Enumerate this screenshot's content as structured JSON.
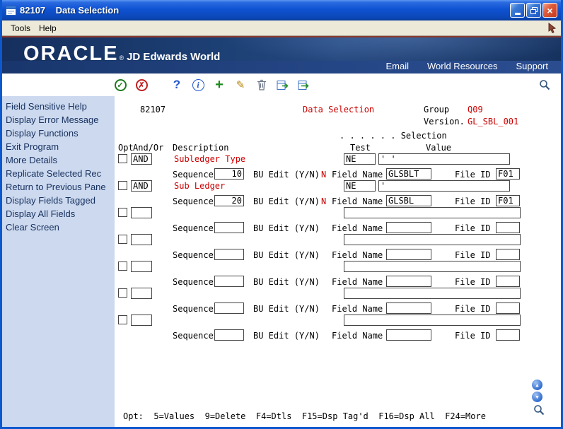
{
  "window": {
    "title": "82107    Data Selection",
    "close_glyph": "×"
  },
  "menubar": {
    "tools": "Tools",
    "help": "Help"
  },
  "banner": {
    "logo": "ORACLE",
    "registered": "®",
    "product": "JD Edwards World",
    "links": {
      "email": "Email",
      "world_resources": "World Resources",
      "support": "Support"
    }
  },
  "toolbar": {
    "icons": [
      "ok",
      "cancel",
      "help",
      "info",
      "add",
      "edit",
      "delete",
      "import",
      "export",
      "search"
    ],
    "glyphs": {
      "ok": "✓",
      "cancel": "✗",
      "help": "?",
      "info": "i",
      "add": "+",
      "edit": "✎"
    }
  },
  "sidebar": {
    "items": [
      "Field Sensitive Help",
      "Display Error Message",
      "Display Functions",
      "Exit Program",
      "More Details",
      "Replicate Selected Rec",
      "Return to Previous Pane",
      "Display Fields Tagged",
      "Display All Fields",
      "Clear Screen"
    ]
  },
  "screen": {
    "program_id": "82107",
    "title": "Data Selection",
    "group_label": "Group",
    "group_value": "Q09",
    "version_label": "Version.",
    "version_value": "GL_SBL_001",
    "selection_header": ". . . . . . Selection",
    "columns": {
      "opt": "Opt",
      "andor": "And/Or",
      "description": "Description",
      "test": "Test",
      "value": "Value"
    },
    "labels": {
      "sequence": "Sequence",
      "bu_edit": "BU Edit (Y/N)",
      "field_name": "Field Name",
      "file_id": "File ID"
    },
    "rows": [
      {
        "andor": "AND",
        "description": "Subledger Type",
        "test": "NE",
        "value": "' '",
        "sequence": "10",
        "bu_edit": "N",
        "field_name": "GLSBLT",
        "file_id": "F01"
      },
      {
        "andor": "AND",
        "description": "Sub Ledger",
        "test": "NE",
        "value": "'",
        "sequence": "20",
        "bu_edit": "N",
        "field_name": "GLSBL",
        "file_id": "F01"
      },
      {
        "andor": "",
        "description": "",
        "test": "",
        "value": "",
        "sequence": "",
        "bu_edit": "",
        "field_name": "",
        "file_id": ""
      },
      {
        "andor": "",
        "description": "",
        "test": "",
        "value": "",
        "sequence": "",
        "bu_edit": "",
        "field_name": "",
        "file_id": ""
      },
      {
        "andor": "",
        "description": "",
        "test": "",
        "value": "",
        "sequence": "",
        "bu_edit": "",
        "field_name": "",
        "file_id": ""
      },
      {
        "andor": "",
        "description": "",
        "test": "",
        "value": "",
        "sequence": "",
        "bu_edit": "",
        "field_name": "",
        "file_id": ""
      },
      {
        "andor": "",
        "description": "",
        "test": "",
        "value": "",
        "sequence": "",
        "bu_edit": "",
        "field_name": "",
        "file_id": ""
      }
    ],
    "footer": "Opt:  5=Values  9=Delete  F4=Dtls  F15=Dsp Tag'd  F16=Dsp All  F24=More"
  },
  "scroll": {
    "up": "▲",
    "down": "▼"
  }
}
